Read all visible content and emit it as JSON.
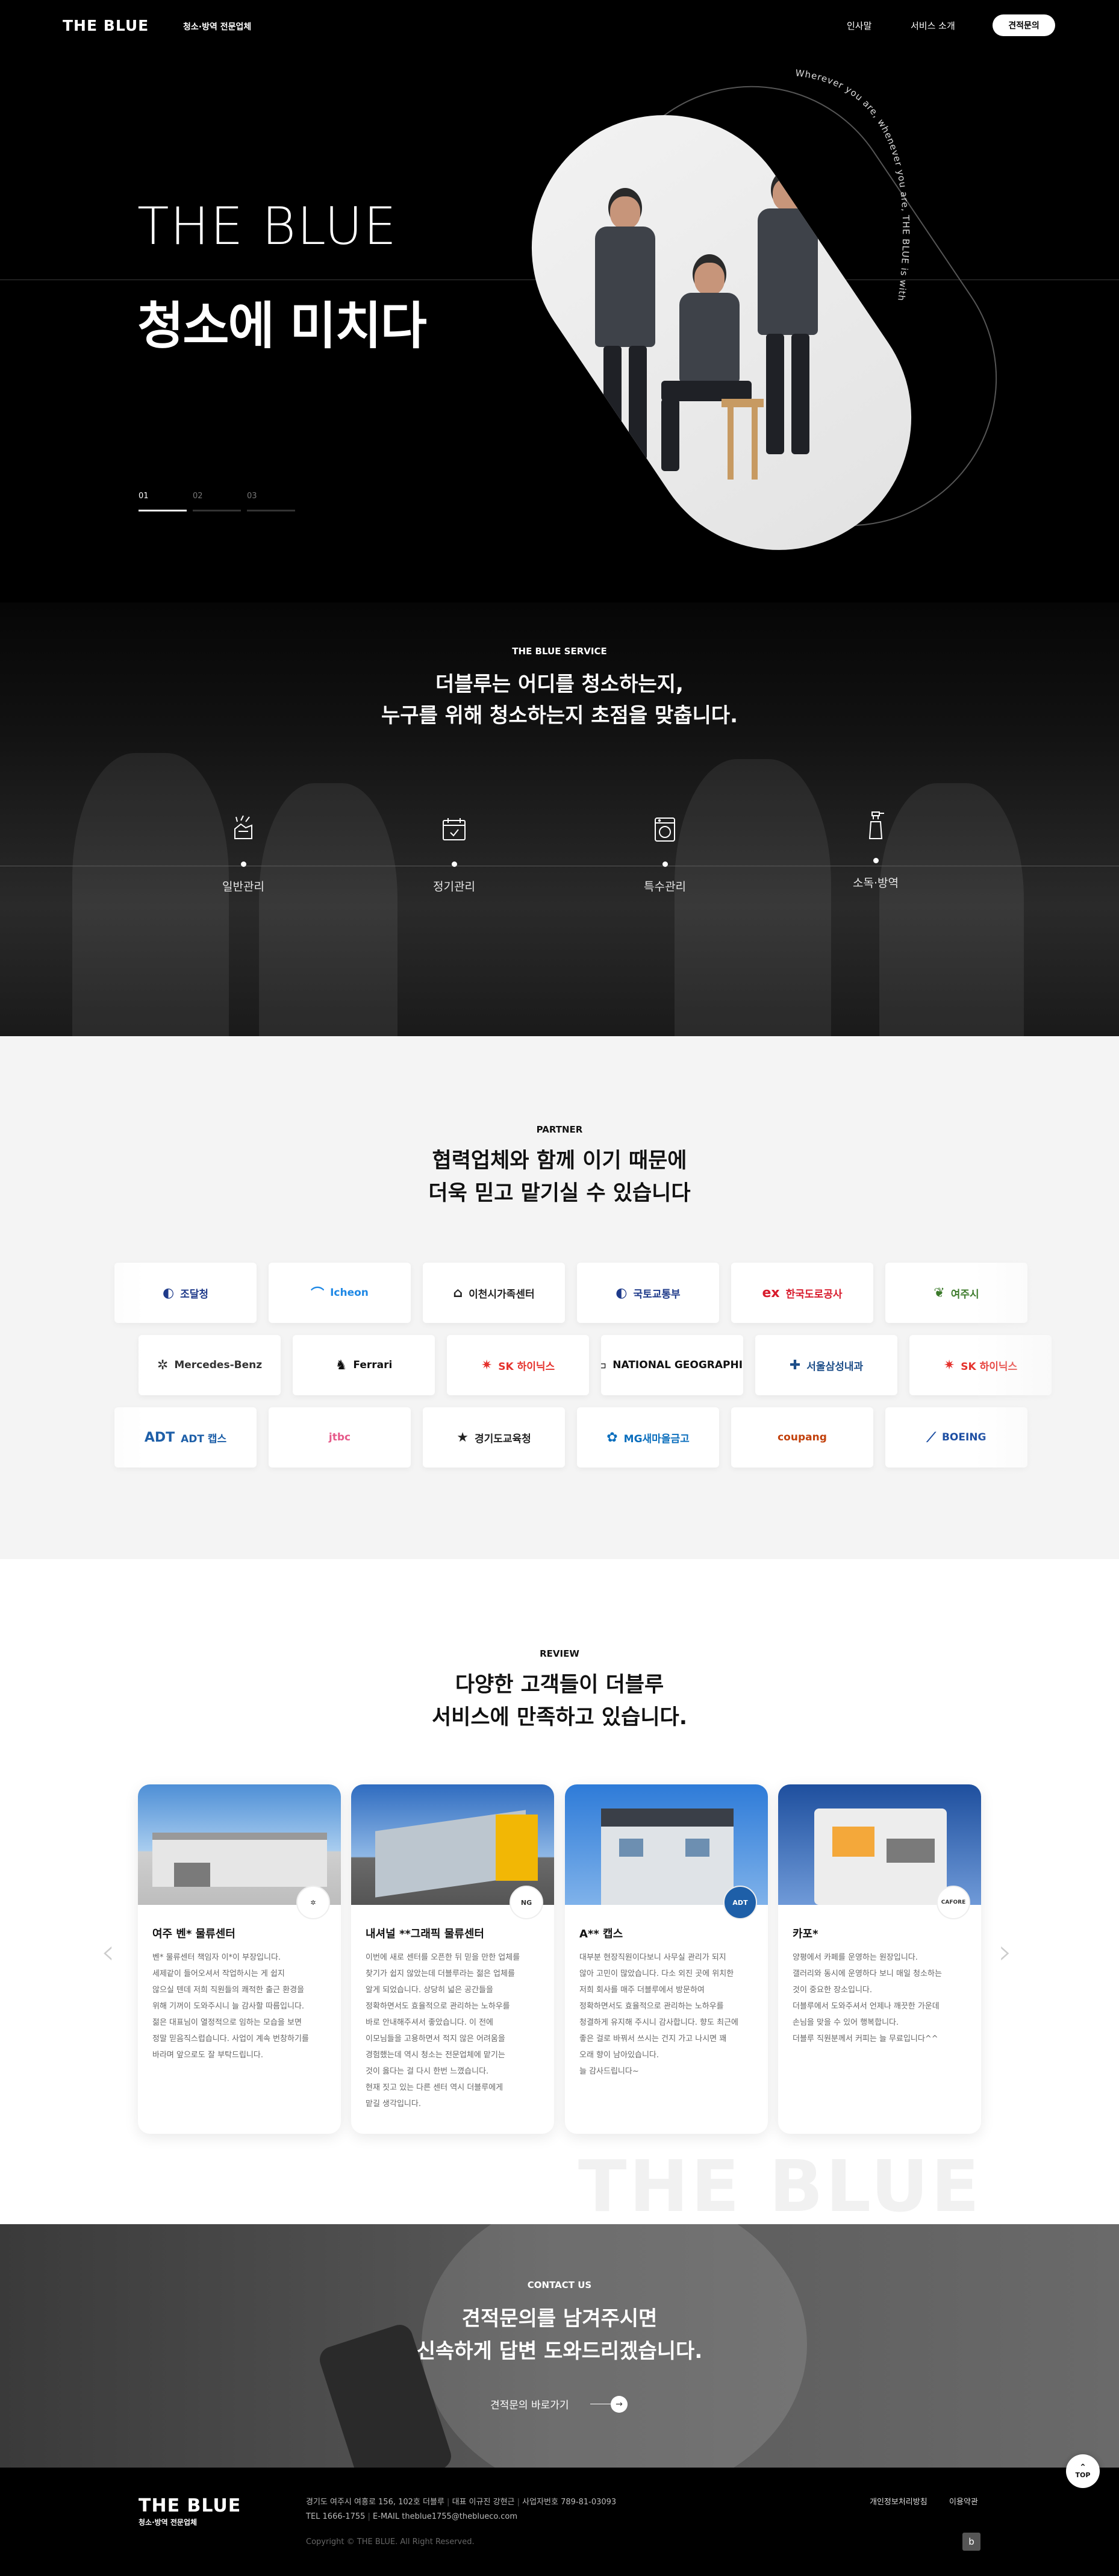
{
  "header": {
    "logo": "THE BLUE",
    "logo_sub": "청소·방역 전문업체",
    "nav": [
      "인사말",
      "서비스 소개"
    ],
    "cta": "견적문의"
  },
  "hero": {
    "title_en": "THE BLUE",
    "title_ko": "청소에 미치다",
    "circle_text": "Wherever you are, whenever you are, THE BLUE is with you",
    "pager": [
      "01",
      "02",
      "03"
    ],
    "pager_active": 0
  },
  "service": {
    "eyebrow": "THE BLUE SERVICE",
    "title_lines": [
      "더블루는 어디를 청소하는지,",
      "누구를 위해 청소하는지 초점을 맞춥니다."
    ],
    "items": [
      {
        "label": "일반관리",
        "icon": "cleaning-hand-icon"
      },
      {
        "label": "정기관리",
        "icon": "calendar-icon"
      },
      {
        "label": "특수관리",
        "icon": "washing-machine-icon"
      },
      {
        "label": "소독·방역",
        "icon": "spray-bottle-icon"
      }
    ]
  },
  "partner": {
    "eyebrow": "PARTNER",
    "title_lines": [
      "협력업체와 함께 이기 때문에",
      "더욱 믿고 맡기실 수 있습니다"
    ],
    "rows": [
      [
        {
          "name": "조달청",
          "mark": "◐",
          "color": "#1e3a8a"
        },
        {
          "name": "Icheon",
          "mark": "⌒",
          "color": "#1e88e5"
        },
        {
          "name": "이천시가족센터",
          "mark": "⌂",
          "color": "#222222"
        },
        {
          "name": "국토교통부",
          "mark": "◐",
          "color": "#1e3a8a"
        },
        {
          "name": "한국도로공사",
          "mark": "ex",
          "color": "#d81b2c"
        },
        {
          "name": "여주시",
          "mark": "❦",
          "color": "#3b7a2a"
        }
      ],
      [
        {
          "name": "Mercedes-Benz",
          "mark": "✲",
          "color": "#333333"
        },
        {
          "name": "Ferrari",
          "mark": "♞",
          "color": "#111111"
        },
        {
          "name": "SK 하이닉스",
          "mark": "✷",
          "color": "#e5322d"
        },
        {
          "name": "NATIONAL GEOGRAPHIC",
          "mark": "▭",
          "color": "#111111"
        },
        {
          "name": "서울삼성내과",
          "mark": "✚",
          "color": "#1d4e89"
        },
        {
          "name": "SK 하이닉스",
          "mark": "✷",
          "color": "#e5322d"
        }
      ],
      [
        {
          "name": "ADT 캡스",
          "mark": "ADT",
          "color": "#1e5fa8"
        },
        {
          "name": "jtbc",
          "mark": "",
          "color": "#e65a8a"
        },
        {
          "name": "경기도교육청",
          "mark": "★",
          "color": "#222222"
        },
        {
          "name": "MG새마을금고",
          "mark": "✿",
          "color": "#0a6ebd"
        },
        {
          "name": "coupang",
          "mark": "",
          "color": "#c2410c"
        },
        {
          "name": "BOEING",
          "mark": "⟋",
          "color": "#1e4fa3"
        }
      ]
    ]
  },
  "review": {
    "eyebrow": "REVIEW",
    "title_lines": [
      "다양한 고객들이 더블루",
      "서비스에 만족하고 있습니다."
    ],
    "cards": [
      {
        "title": "여주 벤* 물류센터",
        "badge": "✲",
        "body": "벤* 물류센터 책임자 이*이 부장입니다.\n세제같이 들어오셔서 작업하시는 게 쉽지\n않으실 텐데 저희 직원들의 쾌적한 출근 환경을\n위해 기꺼이 도와주시니 늘 감사할 따름입니다.\n젊은 대표님이 열정적으로 임하는 모습을 보면\n정말 믿음직스럽습니다. 사업이 계속 번창하기를\n바라며 앞으로도 잘 부탁드립니다."
      },
      {
        "title": "내셔널 **그래픽 물류센터",
        "badge": "NG",
        "body": "이번에 새로 센터를 오픈한 뒤 믿을 만한 업체를\n찾기가 쉽지 않았는데 더블루라는 젊은 업체를\n알게 되었습니다. 상당히 넓은 공간들을\n정확하면서도 효율적으로 관리하는 노하우를\n바로 안내해주셔서 좋았습니다. 이 전에\n이모님들을 고용하면서 적지 않은 어려움을\n경험했는데 역시 청소는 전문업체에 맡기는\n것이 옳다는 걸 다시 한번 느꼈습니다.\n현재 짓고 있는 다른 센터 역시 더블루에게\n맡길 생각입니다."
      },
      {
        "title": "A** 캡스",
        "badge": "ADT",
        "body": "대부분 현장직원이다보니 사무실 관리가 되지\n않아 고민이 많았습니다. 다소 외진 곳에 위치한\n저희 회사를 매주 더블루에서 방문하여\n정확하면서도 효율적으로 관리하는 노하우를\n청결하게 유지해 주시니 감사합니다. 향도 최근에\n좋은 걸로 바꿔서 쓰시는 건지 가고 나시면 꽤\n오래 향이 남아있습니다.\n늘 감사드립니다~"
      },
      {
        "title": "카포*",
        "badge": "CAFORE",
        "body": "양평에서 카페를 운영하는 원장입니다.\n갤러리와 동시에 운영하다 보니 매일 청소하는\n것이 중요한 장소입니다.\n더블루에서 도와주셔서 언제나 깨끗한 가운데\n손님을 맞을 수 있어 행복합니다.\n더블루 직원분께서 커피는 늘 무료입니다^^"
      }
    ],
    "watermark": "THE BLUE"
  },
  "contact": {
    "eyebrow": "CONTACT US",
    "title_lines": [
      "견적문의를 남겨주시면",
      "신속하게 답변 도와드리겠습니다."
    ],
    "link": "견적문의 바로가기"
  },
  "footer": {
    "logo": "THE BLUE",
    "logo_sub": "청소·방역 전문업체",
    "address": "경기도 여주시 여흥로 156, 102호 더블루",
    "ceo": "대표 이규진 강현근",
    "bizno": "사업자번호 789-81-03093",
    "tel": "TEL 1666-1755",
    "email": "E-MAIL theblue1755@theblueco.com",
    "copyright": "Copyright © THE BLUE. All Right Reserved.",
    "links": [
      "개인정보처리방침",
      "이용약관"
    ],
    "social": "b"
  },
  "top_button": "TOP",
  "colors": {
    "accent": "#000000",
    "background_light": "#f4f4f4",
    "card_title": "#111111"
  }
}
